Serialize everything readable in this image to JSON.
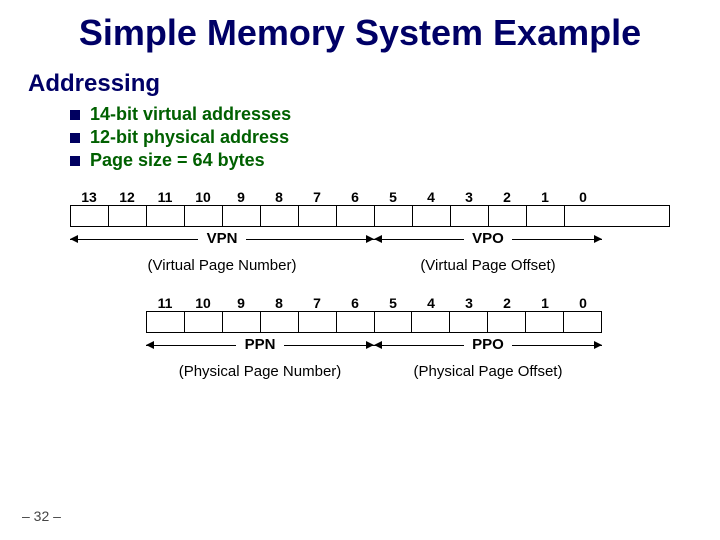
{
  "title": "Simple Memory System Example",
  "section": "Addressing",
  "bullets": [
    "14-bit virtual addresses",
    "12-bit physical address",
    "Page size = 64 bytes"
  ],
  "va_bits": [
    "13",
    "12",
    "11",
    "10",
    "9",
    "8",
    "7",
    "6",
    "5",
    "4",
    "3",
    "2",
    "1",
    "0"
  ],
  "pa_bits": [
    "11",
    "10",
    "9",
    "8",
    "7",
    "6",
    "5",
    "4",
    "3",
    "2",
    "1",
    "0"
  ],
  "labels": {
    "vpn": "VPN",
    "vpo": "VPO",
    "vpn_full": "(Virtual Page Number)",
    "vpo_full": "(Virtual Page Offset)",
    "ppn": "PPN",
    "ppo": "PPO",
    "ppn_full": "(Physical Page Number)",
    "ppo_full": "(Physical Page Offset)"
  },
  "slide_num": "– 32 –"
}
